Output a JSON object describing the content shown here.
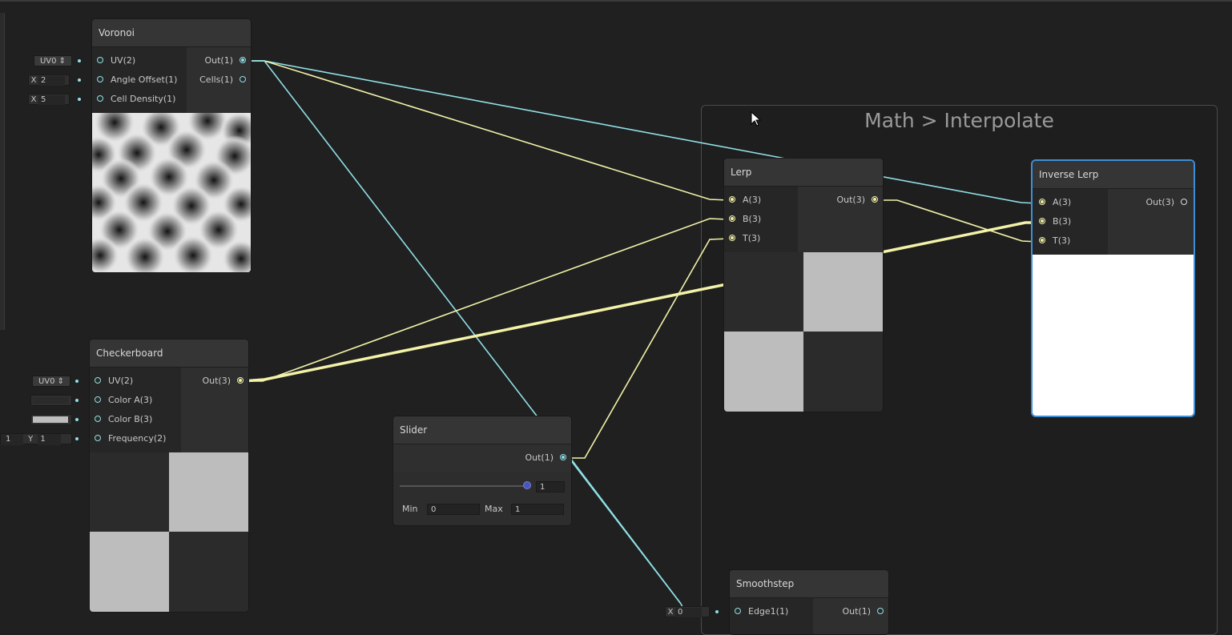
{
  "group": {
    "title": "Math > Interpolate"
  },
  "voronoi": {
    "title": "Voronoi",
    "inputs": [
      "UV(2)",
      "Angle Offset(1)",
      "Cell Density(1)"
    ],
    "outputs": [
      "Out(1)",
      "Cells(1)"
    ],
    "uv_value": "UV0 ⇕",
    "angle": {
      "label": "X",
      "value": "2"
    },
    "density": {
      "label": "X",
      "value": "5"
    }
  },
  "checkerboard": {
    "title": "Checkerboard",
    "inputs": [
      "UV(2)",
      "Color A(3)",
      "Color B(3)",
      "Frequency(2)"
    ],
    "outputs": [
      "Out(3)"
    ],
    "uv_value": "UV0 ⇕",
    "freq_x": "1",
    "freq_y_label": "Y",
    "freq_y": "1",
    "color_a": "#2b2b2b",
    "color_b": "#bdbdbd"
  },
  "slider": {
    "title": "Slider",
    "output": "Out(1)",
    "value": "1",
    "value_fraction": 1,
    "min_label": "Min",
    "min": "0",
    "max_label": "Max",
    "max": "1"
  },
  "lerp": {
    "title": "Lerp",
    "inputs": [
      "A(3)",
      "B(3)",
      "T(3)"
    ],
    "outputs": [
      "Out(3)"
    ]
  },
  "inverse_lerp": {
    "title": "Inverse Lerp",
    "inputs": [
      "A(3)",
      "B(3)",
      "T(3)"
    ],
    "outputs": [
      "Out(3)"
    ]
  },
  "smoothstep": {
    "title": "Smoothstep",
    "inputs": [
      "Edge1(1)"
    ],
    "outputs": [
      "Out(1)"
    ],
    "edge1": {
      "label": "X",
      "value": "0"
    }
  },
  "colors": {
    "background": "#202020",
    "wire_float": "#8fe0e6",
    "wire_vector3": "#f3f2a8",
    "selection": "#3f8fd6"
  }
}
